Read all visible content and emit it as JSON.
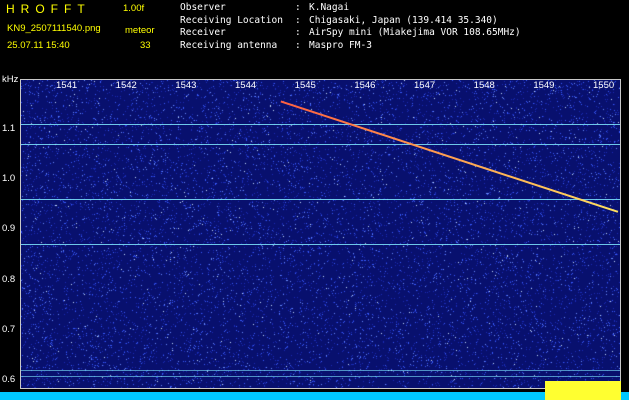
{
  "header": {
    "app_name": "HROFFT",
    "version": "1.00f",
    "file_name": "KN9_2507111540.png",
    "mode": "meteor",
    "date_time": "25.07.11 15:40",
    "meteor_count": "33"
  },
  "info": [
    {
      "key": "Observer",
      "sep": ":",
      "value": "K.Nagai"
    },
    {
      "key": "Receiving Location",
      "sep": ":",
      "value": "Chigasaki, Japan (139.414 35.340)"
    },
    {
      "key": "Receiver",
      "sep": ":",
      "value": "AirSpy mini (Miakejima VOR 108.65MHz)"
    },
    {
      "key": "Receiving antenna",
      "sep": ":",
      "value": "Maspro FM-3"
    }
  ],
  "spectrogram": {
    "unit": "kHz",
    "x_ticks": [
      "1541",
      "1542",
      "1543",
      "1544",
      "1545",
      "1546",
      "1547",
      "1548",
      "1549",
      "1550"
    ],
    "y_ticks": [
      "1.1",
      "1.0",
      "0.9",
      "0.8",
      "0.7",
      "0.6"
    ],
    "colors": {
      "background": "#08106e",
      "noise_bright": "#3a5cff",
      "carrier_line": "#7fe8ff",
      "meteor_head": "#ff6040",
      "meteor_tail": "#ffe060",
      "bottom_bar": "#00c8ff",
      "bottom_bar_highlight": "#ffff30"
    },
    "carrier_lines_khz": [
      1.11,
      1.07,
      0.96,
      0.87,
      0.62,
      0.607
    ],
    "meteor_trail": {
      "start": {
        "time_min": 1544.6,
        "freq_khz": 1.155
      },
      "end": {
        "time_min": 1550.25,
        "freq_khz": 0.935
      }
    }
  }
}
